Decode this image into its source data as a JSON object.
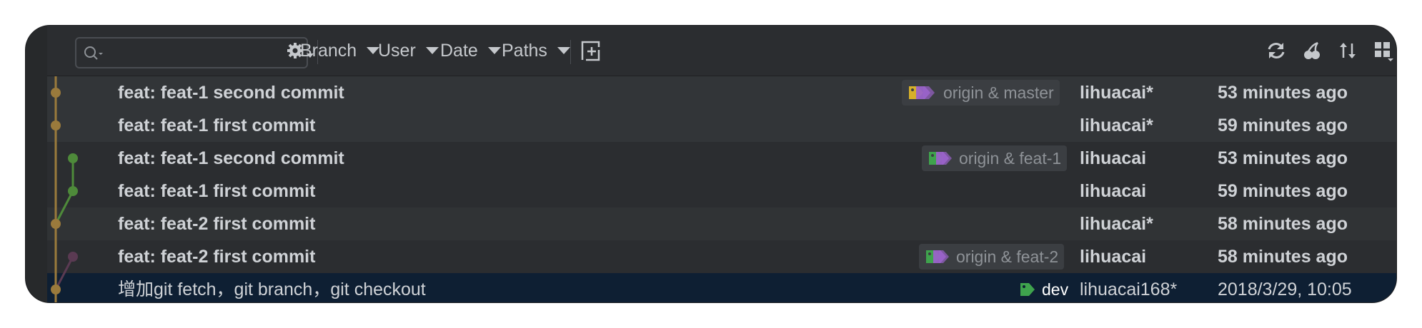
{
  "search": {
    "placeholder": ""
  },
  "toolbar": {
    "filters": [
      {
        "label": "Branch"
      },
      {
        "label": "User"
      },
      {
        "label": "Date"
      },
      {
        "label": "Paths"
      }
    ],
    "icons": [
      "settings-icon",
      "new-tab-icon",
      "refresh-icon",
      "cherry-pick-icon",
      "sort-icon",
      "layout-options-icon"
    ]
  },
  "commits": [
    {
      "message": "feat: feat-1 second commit",
      "ref": "origin & master",
      "author": "lihuacai*",
      "date": "53 minutes ago",
      "bg": "#323538",
      "bold": true
    },
    {
      "message": "feat: feat-1 first commit",
      "ref": "",
      "author": "lihuacai*",
      "date": "59 minutes ago",
      "bg": "#323538",
      "bold": true
    },
    {
      "message": "feat: feat-1 second commit",
      "ref": "origin & feat-1",
      "author": "lihuacai",
      "date": "53 minutes ago",
      "bg": "#2b2d30",
      "bold": true
    },
    {
      "message": "feat: feat-1 first commit",
      "ref": "",
      "author": "lihuacai",
      "date": "59 minutes ago",
      "bg": "#2b2d30",
      "bold": true
    },
    {
      "message": "feat: feat-2 first commit",
      "ref": "",
      "author": "lihuacai*",
      "date": "58 minutes ago",
      "bg": "#303335",
      "bold": true
    },
    {
      "message": "feat: feat-2 first commit",
      "ref": "origin & feat-2",
      "author": "lihuacai",
      "date": "58 minutes ago",
      "bg": "#2b2d30",
      "bold": true
    },
    {
      "message": "增加git fetch，git branch，git checkout",
      "ref": "dev",
      "author": "lihuacai168*",
      "date": "2018/3/29, 10:05",
      "bg": "#0e1f33",
      "bold": false
    }
  ],
  "colors": {
    "branch_gold": "#9a7a3c",
    "branch_green": "#4e8a3a",
    "branch_purple": "#5a3a52",
    "tag_yellow": "#d6b02a",
    "tag_purple": "#9a63c9",
    "tag_green": "#3fa34d"
  }
}
